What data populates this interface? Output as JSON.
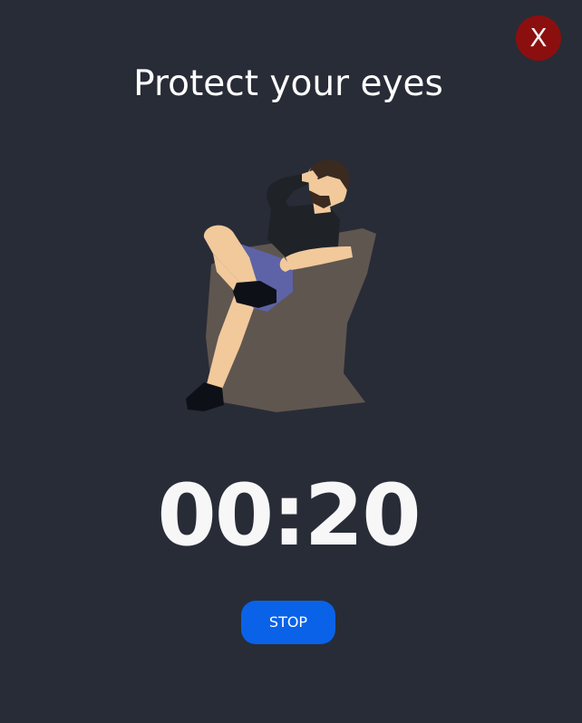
{
  "window": {
    "close_label": "X"
  },
  "main": {
    "title": "Protect your eyes",
    "timer": "00:20",
    "stop_label": "STOP",
    "illustration_icon": "relaxing-man-in-chair-illustration"
  },
  "colors": {
    "background": "#282c37",
    "close_button": "#8b0f0f",
    "stop_button": "#0a62e8",
    "text": "#ffffff"
  }
}
